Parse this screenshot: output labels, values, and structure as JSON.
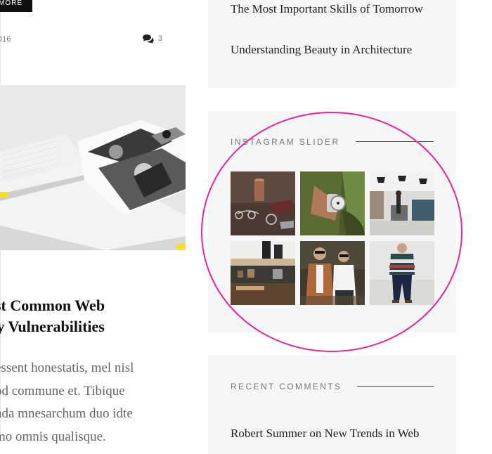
{
  "post": {
    "read_more_label": "MORE",
    "date": "016",
    "comment_count": "3",
    "title_line1": "ost Common Web",
    "title_line2": "ity Vulnerabilities",
    "excerpt": "essent honestatis, mel nisl\nod commune et. Tibique\nnda mnesarchum duo idte\nmo omnis qualisque."
  },
  "sidebar": {
    "recent_posts": [
      {
        "title": "The Most Important Skills of Tomorrow"
      },
      {
        "title": "Understanding Beauty in Architecture"
      }
    ],
    "instagram": {
      "heading": "INSTAGRAM SLIDER",
      "photos": [
        "leather-goods-icon",
        "wristwatch-icon",
        "workshop-icon",
        "cafe-counter-icon",
        "two-men-icon",
        "striped-sweater-man-icon"
      ]
    },
    "recent_comments": {
      "heading": "RECENT COMMENTS",
      "first_author": "Robert Summer",
      "first_joiner": "on",
      "first_post": "New Trends in Web"
    }
  },
  "colors": {
    "widget_bg": "#f6f6f6",
    "annotation": "#e8259a",
    "button_bg": "#111111"
  }
}
